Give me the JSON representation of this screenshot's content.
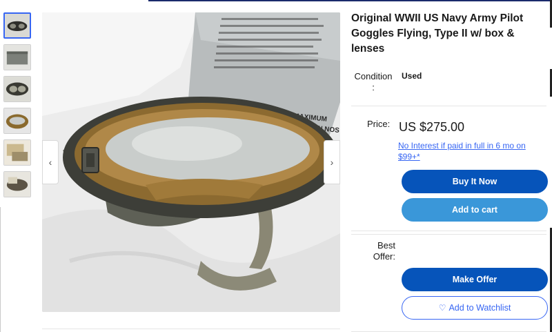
{
  "listing": {
    "title": "Original WWII US Navy Army Pilot Goggles Flying, Type II w/ box & lenses",
    "condition_label": "Condition\n:",
    "condition_value": "Used"
  },
  "gallery": {
    "thumbnail_count": 6,
    "selected_index": 3,
    "prev_glyph": "‹",
    "next_glyph": "›",
    "box_text_line1": "TO PROVIDE MAXIMUM",
    "box_text_line2": "GOGGLES AS LOW ON NOS"
  },
  "pricing": {
    "price_label": "Price:",
    "price_value": "US $275.00",
    "finance_text": "No Interest if paid in full in 6 mo on $99+*"
  },
  "actions": {
    "buy_now": "Buy It Now",
    "add_to_cart": "Add to cart",
    "best_offer_label": "Best Offer:",
    "make_offer": "Make Offer",
    "watchlist": "Add to Watchlist",
    "watchlist_icon": "heart-outline-icon"
  },
  "colors": {
    "primary_blue": "#0654ba",
    "cart_blue": "#3a97d9",
    "link_blue": "#3665f3"
  }
}
